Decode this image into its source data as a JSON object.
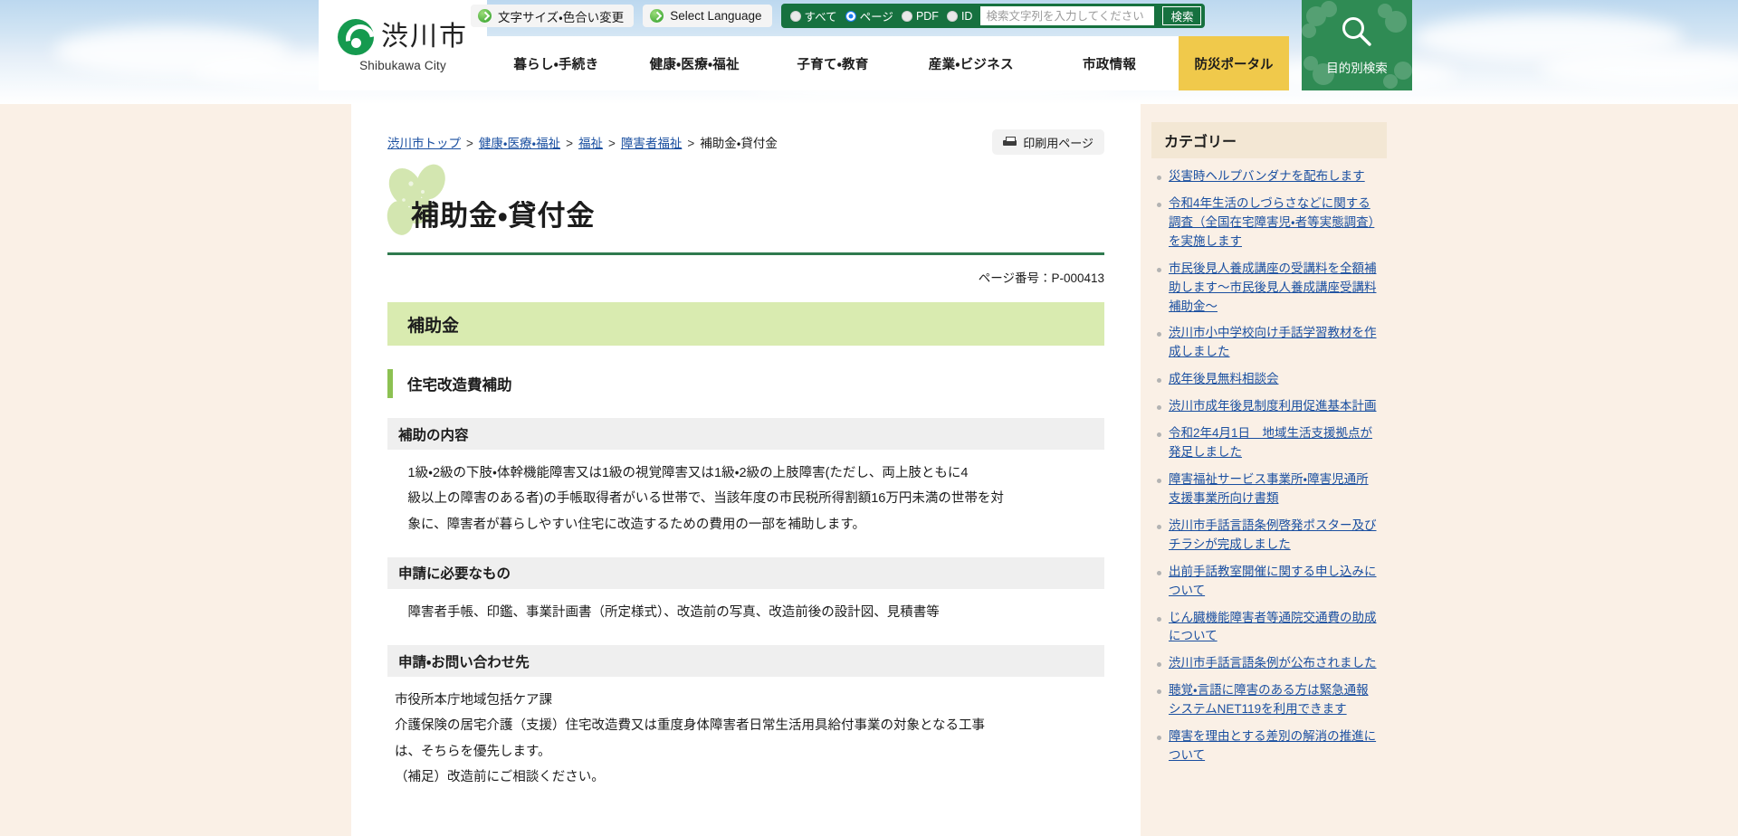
{
  "header": {
    "logo_ja": "渋川市",
    "logo_en": "Shibukawa City",
    "utilities": [
      {
        "label": "文字サイズ・色合い変更",
        "icon": "arrow-circle-icon"
      },
      {
        "label": "Select Language",
        "icon": "arrow-circle-icon"
      }
    ],
    "search": {
      "radios": [
        {
          "label": "すべて",
          "selected": false
        },
        {
          "label": "ページ",
          "selected": true
        },
        {
          "label": "PDF",
          "selected": false
        },
        {
          "label": "ID",
          "selected": false
        }
      ],
      "placeholder": "検索文字列を入力してください",
      "value": "",
      "button_label": "検索"
    },
    "nav": [
      {
        "label": "暮らし・手続き"
      },
      {
        "label": "健康・医療・福祉"
      },
      {
        "label": "子育て・教育"
      },
      {
        "label": "産業・ビジネス"
      },
      {
        "label": "市政情報"
      }
    ],
    "bousai_label": "防災ポータル",
    "mokuteki_label": "目的別検索",
    "accent_green": "#16713f",
    "bousai_yellow": "#f0c94b"
  },
  "breadcrumb": {
    "items": [
      {
        "label": "渋川市トップ",
        "link": true
      },
      {
        "label": "健康・医療・福祉",
        "link": true
      },
      {
        "label": "福祉",
        "link": true
      },
      {
        "label": "障害者福祉",
        "link": true
      },
      {
        "label": "補助金・貸付金",
        "link": false
      }
    ],
    "separator": ">"
  },
  "print_button": {
    "label": "印刷用ページ",
    "icon": "printer-icon"
  },
  "main": {
    "title": "補助金・貸付金",
    "page_number_label": "ページ番号：P-000413",
    "h2": "補助金",
    "h3": "住宅改造費補助",
    "sections": [
      {
        "heading": "補助の内容",
        "lines": [
          "1級・2級の下肢・体幹機能障害又は1級の視覚障害又は1級・2級の上肢障害(ただし、両上肢ともに4",
          "級以上の障害のある者)の手帳取得者がいる世帯で、当該年度の市民税所得割額16万円未満の世帯を対",
          "象に、障害者が暮らしやすい住宅に改造するための費用の一部を補助します。"
        ]
      },
      {
        "heading": "申請に必要なもの",
        "lines": [
          "障害者手帳、印鑑、事業計画書（所定様式）、改造前の写真、改造前後の設計図、見積書等"
        ]
      },
      {
        "heading": "申請・お問い合わせ先",
        "lines": [
          "市役所本庁地域包括ケア課",
          "介護保険の居宅介護（支援）住宅改造費又は重度身体障害者日常生活用具給付事業の対象となる工事",
          "は、そちらを優先します。",
          "（補足）改造前にご相談ください。"
        ]
      }
    ]
  },
  "sidebar": {
    "heading": "カテゴリー",
    "links": [
      "災害時ヘルプバンダナを配布します",
      "令和4年生活のしづらさなどに関する調査（全国在宅障害児・者等実態調査）を実施します",
      "市民後見人養成講座の受講料を全額補助します～市民後見人養成講座受講料補助金～",
      "渋川市小中学校向け手話学習教材を作成しました",
      "成年後見無料相談会",
      "渋川市成年後見制度利用促進基本計画",
      "令和2年4月1日　地域生活支援拠点が発足しました",
      "障害福祉サービス事業所・障害児通所支援事業所向け書類",
      "渋川市手話言語条例啓発ポスター及びチラシが完成しました",
      "出前手話教室開催に関する申し込みについて",
      "じん臓機能障害者等通院交通費の助成について",
      "渋川市手話言語条例が公布されました",
      "聴覚・言語に障害のある方は緊急通報システムNET119を利用できます",
      "障害を理由とする差別の解消の推進について"
    ]
  }
}
